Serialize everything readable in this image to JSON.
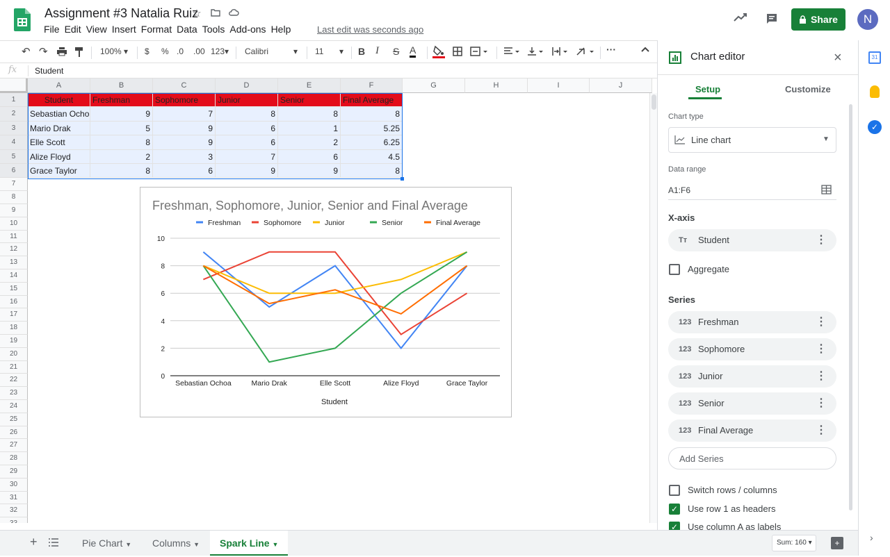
{
  "app": {
    "doc_title": "Assignment #3 Natalia Ruiz",
    "menu": [
      "File",
      "Edit",
      "View",
      "Insert",
      "Format",
      "Data",
      "Tools",
      "Add-ons",
      "Help"
    ],
    "last_edit": "Last edit was seconds ago",
    "share_label": "Share",
    "avatar_initial": "N"
  },
  "toolbar": {
    "zoom": "100%",
    "currency": "$",
    "percent": "%",
    "dec_less": ".0",
    "dec_more": ".00",
    "more_formats": "123",
    "font": "Calibri",
    "font_size": "11",
    "bold": "B",
    "italic": "I",
    "strike": "S",
    "text_color": "A"
  },
  "formula_bar": {
    "fx": "fx",
    "value": "Student"
  },
  "columns": [
    "A",
    "B",
    "C",
    "D",
    "E",
    "F",
    "G",
    "H",
    "I",
    "J"
  ],
  "rows": [
    "1",
    "2",
    "3",
    "4",
    "5",
    "6",
    "7",
    "8",
    "9",
    "10",
    "11",
    "12",
    "13",
    "14",
    "15",
    "16",
    "17",
    "18",
    "19",
    "20",
    "21",
    "22",
    "23",
    "24",
    "25",
    "26",
    "27",
    "28",
    "29",
    "30",
    "31",
    "32",
    "33"
  ],
  "table": {
    "headers": [
      "Student",
      "Freshman",
      "Sophomore",
      "Junior",
      "Senior",
      "Final Average"
    ],
    "rows": [
      [
        "Sebastian Ochoa",
        "9",
        "7",
        "8",
        "8",
        "8"
      ],
      [
        "Mario Drak",
        "5",
        "9",
        "6",
        "1",
        "5.25"
      ],
      [
        "Elle Scott",
        "8",
        "9",
        "6",
        "2",
        "6.25"
      ],
      [
        "Alize Floyd",
        "2",
        "3",
        "7",
        "6",
        "4.5"
      ],
      [
        "Grace Taylor",
        "8",
        "6",
        "9",
        "9",
        "8"
      ]
    ]
  },
  "chart_data": {
    "type": "line",
    "title": "Freshman, Sophomore, Junior, Senior and Final Average",
    "xlabel": "Student",
    "ylabel": "",
    "categories": [
      "Sebastian Ochoa",
      "Mario Drak",
      "Elle Scott",
      "Alize Floyd",
      "Grace Taylor"
    ],
    "ylim": [
      0,
      10
    ],
    "yticks": [
      "10",
      "8",
      "6",
      "4",
      "2",
      "0"
    ],
    "grid": true,
    "legend": "top",
    "series": [
      {
        "name": "Freshman",
        "color": "#4285f4",
        "values": [
          9,
          5,
          8,
          2,
          8
        ]
      },
      {
        "name": "Sophomore",
        "color": "#ea4335",
        "values": [
          7,
          9,
          9,
          3,
          6
        ]
      },
      {
        "name": "Junior",
        "color": "#fbbc04",
        "values": [
          8,
          6,
          6,
          7,
          9
        ]
      },
      {
        "name": "Senior",
        "color": "#34a853",
        "values": [
          8,
          1,
          2,
          6,
          9
        ]
      },
      {
        "name": "Final Average",
        "color": "#ff6d01",
        "values": [
          8,
          5.25,
          6.25,
          4.5,
          8
        ]
      }
    ]
  },
  "editor": {
    "title": "Chart editor",
    "tab_setup": "Setup",
    "tab_customize": "Customize",
    "chart_type_label": "Chart type",
    "chart_type_value": "Line chart",
    "data_range_label": "Data range",
    "data_range_value": "A1:F6",
    "xaxis_label": "X-axis",
    "xaxis_value": "Student",
    "aggregate_label": "Aggregate",
    "series_label": "Series",
    "series_items": [
      "Freshman",
      "Sophomore",
      "Junior",
      "Senior",
      "Final Average"
    ],
    "series_badge": "123",
    "xaxis_badge": "Tт",
    "add_series": "Add Series",
    "switch_rows": "Switch rows / columns",
    "use_row1": "Use row 1 as headers",
    "use_colA": "Use column A as labels"
  },
  "sheets": {
    "tabs": [
      "Pie Chart",
      "Columns",
      "Spark Line"
    ],
    "active": "Spark Line",
    "sum": "Sum: 160"
  },
  "colors": {
    "accent": "#188038",
    "header_fill": "#e30c1a",
    "selection": "#e8f0fe"
  }
}
